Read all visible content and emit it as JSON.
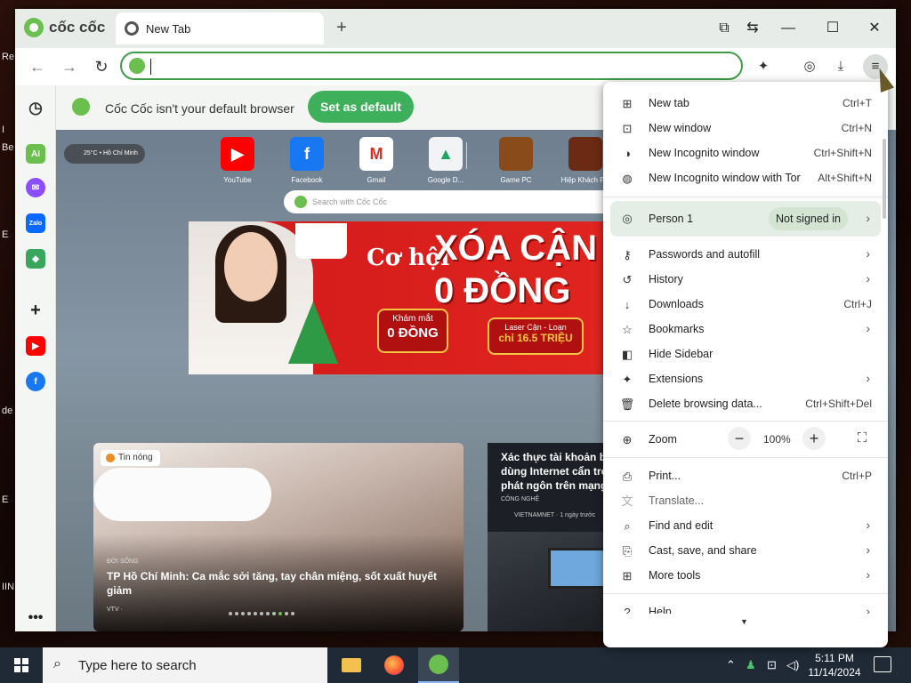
{
  "desktop_fragments": [
    "Re",
    "I",
    "Be",
    "E",
    "de",
    "E",
    "IIN"
  ],
  "browser": {
    "brand": "cốc cốc",
    "tab_title": "New Tab",
    "omnibox_value": ""
  },
  "infobar": {
    "message": "Cốc Cốc isn't your default browser",
    "button": "Set as default"
  },
  "sidebar": {
    "ai_label": "AI",
    "zalo_label": "Zalo"
  },
  "newtab": {
    "weather": "25°C • Hồ Chí Minh",
    "search_placeholder": "Search with Cốc Cốc",
    "tiles": [
      {
        "label": "YouTube",
        "color": "#ff0000",
        "glyph": "▶"
      },
      {
        "label": "Facebook",
        "color": "#1877f2",
        "glyph": "f"
      },
      {
        "label": "Gmail",
        "color": "#ffffff",
        "glyph": "M"
      },
      {
        "label": "Google D...",
        "color": "#f1f3f4",
        "glyph": "▲"
      },
      {
        "label": "Game PC",
        "color": "#8a4b1a",
        "glyph": ""
      },
      {
        "label": "Hiệp Khách PC",
        "color": "#6b2a14",
        "glyph": ""
      }
    ],
    "banner": {
      "line1": "Cơ hội",
      "line2": "XÓA CẬN",
      "line3": "0 ĐỒNG",
      "promo1_top": "Khám mắt",
      "promo1_bottom": "0 ĐỒNG",
      "promo2_top": "Laser Cận - Loạn",
      "promo2_bottom": "chỉ 16.5 TRIỆU"
    },
    "card1": {
      "badge": "Tin nóng",
      "category": "ĐỜI SỐNG",
      "title": "TP Hồ Chí Minh: Ca mắc sởi tăng, tay chân miệng, sốt xuất huyết giảm",
      "source": "VTV ·"
    },
    "card2": {
      "title": "Xác thực tài khoản buộc dùng Internet cẩn trọng phát ngôn trên mạng",
      "category": "CÔNG NGHỆ",
      "source": "VIETNAMNET · 1 ngày trước"
    }
  },
  "menu": {
    "items": [
      {
        "label": "New tab",
        "shortcut": "Ctrl+T",
        "icon": "⊞"
      },
      {
        "label": "New window",
        "shortcut": "Ctrl+N",
        "icon": "⊡"
      },
      {
        "label": "New Incognito window",
        "shortcut": "Ctrl+Shift+N",
        "icon": "◑"
      },
      {
        "label": "New Incognito window with Tor",
        "shortcut": "Alt+Shift+N",
        "icon": "◍"
      }
    ],
    "person": {
      "label": "Person 1",
      "status": "Not signed in"
    },
    "items2": [
      {
        "label": "Passwords and autofill",
        "shortcut": "",
        "arrow": "›",
        "icon": "⚷"
      },
      {
        "label": "History",
        "shortcut": "",
        "arrow": "›",
        "icon": "↺"
      },
      {
        "label": "Downloads",
        "shortcut": "Ctrl+J",
        "arrow": "",
        "icon": "↓"
      },
      {
        "label": "Bookmarks",
        "shortcut": "",
        "arrow": "›",
        "icon": "☆"
      },
      {
        "label": "Hide Sidebar",
        "shortcut": "",
        "arrow": "",
        "icon": "◧"
      },
      {
        "label": "Extensions",
        "shortcut": "",
        "arrow": "›",
        "icon": "✦"
      },
      {
        "label": "Delete browsing data...",
        "shortcut": "Ctrl+Shift+Del",
        "arrow": "",
        "icon": "🗑"
      }
    ],
    "zoom": {
      "label": "Zoom",
      "value": "100%",
      "minus": "−",
      "plus": "+"
    },
    "items3": [
      {
        "label": "Print...",
        "shortcut": "Ctrl+P",
        "arrow": "",
        "icon": "⎙"
      },
      {
        "label": "Translate...",
        "shortcut": "",
        "arrow": "",
        "icon": "文"
      },
      {
        "label": "Find and edit",
        "shortcut": "",
        "arrow": "›",
        "icon": "⌕"
      },
      {
        "label": "Cast, save, and share",
        "shortcut": "",
        "arrow": "›",
        "icon": "⎘"
      },
      {
        "label": "More tools",
        "shortcut": "",
        "arrow": "›",
        "icon": "⊞"
      },
      {
        "label": "Help",
        "shortcut": "",
        "arrow": "›",
        "icon": "?"
      }
    ]
  },
  "taskbar": {
    "search_placeholder": "Type here to search",
    "time": "5:11 PM",
    "date": "11/14/2024"
  }
}
